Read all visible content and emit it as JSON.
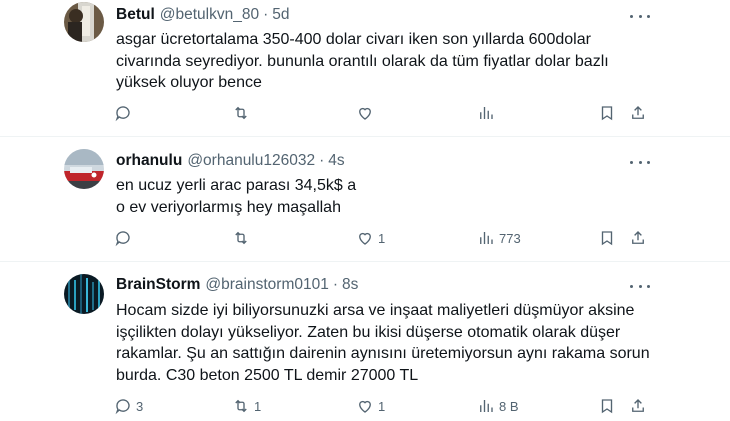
{
  "tweets": [
    {
      "name": "Betul",
      "handle": "@betulkvn_80",
      "dot": "·",
      "time": "5d",
      "lines": [
        "asgar ücretortalama  350-400 dolar civarı iken son yıllarda 600dolar",
        "civarında  seyrediyor. bununla orantılı olarak da tüm fiyatlar  dolar bazlı",
        "yüksek oluyor bence"
      ],
      "replies": "",
      "reposts": "",
      "likes": "",
      "views": ""
    },
    {
      "name": "orhanulu",
      "handle": "@orhanulu126032",
      "dot": "·",
      "time": "4s",
      "lines": [
        "en ucuz yerli arac parası 34,5k$ a",
        "o ev veriyorlarmış hey maşallah"
      ],
      "replies": "",
      "reposts": "",
      "likes": "1",
      "views": "773"
    },
    {
      "name": "BrainStorm",
      "handle": "@brainstorm0101",
      "dot": "·",
      "time": "8s",
      "lines": [
        "Hocam sizde iyi biliyorsunuzki arsa ve inşaat maliyetleri düşmüyor aksine",
        "işçilikten dolayı yükseliyor. Zaten bu ikisi düşerse otomatik olarak düşer",
        "rakamlar. Şu an sattığın dairenin aynısını üretemiyorsun aynı rakama sorun",
        "burda. C30 beton 2500 TL demir 27000 TL"
      ],
      "replies": "3",
      "reposts": "1",
      "likes": "1",
      "views": "8 B"
    }
  ],
  "colors": {
    "text_primary": "#0f1419",
    "text_secondary": "#536471",
    "divider": "#eff3f4"
  },
  "icons": [
    "reply-icon",
    "repost-icon",
    "like-icon",
    "views-icon",
    "bookmark-icon",
    "share-icon",
    "more-icon"
  ]
}
